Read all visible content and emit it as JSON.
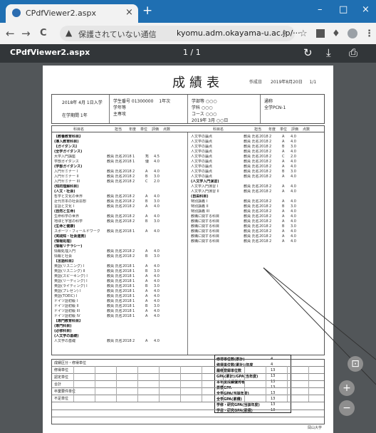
{
  "browser": {
    "tab_title": "CPdfViewer2.aspx",
    "tab_close": "×",
    "new_tab": "+",
    "win_min": "–",
    "win_max": "□",
    "win_close": "×"
  },
  "nav": {
    "back": "←",
    "forward": "→",
    "reload": "C"
  },
  "omnibox": {
    "warning": "▲",
    "security_text": "保護されていない通信",
    "url": "kyomu.adm.okayama-u.ac.jp/···"
  },
  "pdf": {
    "file_name": "CPdfViewer2.aspx",
    "page_indicator": "1 / 1"
  },
  "document": {
    "title": "成績表",
    "top_right": "作成日　　2019年8月20日 　 1/1",
    "header_cells": [
      "2018年 4月 1日入学",
      "在学期間 1年",
      "学生番号 01300000 　1年次",
      "学年等",
      "主専攻",
      "学部等 ○○○",
      "学科 ○○○",
      "コース ○○○",
      "2019年 3月 ○○日",
      "通称",
      "全学PCN-1"
    ],
    "column_headers": [
      "科目名",
      "担当",
      "年度",
      "単位",
      "評価",
      "点数",
      "科目名",
      "担当",
      "年度",
      "単位",
      "評価",
      "点数"
    ],
    "left_rows": [
      {
        "name": "【教養教育科目】",
        "bold": true
      },
      {
        "name": "(導入教育科目)",
        "bold": true
      },
      {
        "name": "【ガイダンス】",
        "bold": true
      },
      {
        "name": "(全学ガイダンス)",
        "bold": true
      },
      {
        "name": "大学入門講座",
        "d1": "教員 氏名",
        "d2": "2018",
        "d3": "1",
        "g": "秀",
        "r": "4.5"
      },
      {
        "name": "学部ガイダンス",
        "d1": "教員 氏名",
        "d2": "2018",
        "d3": "1",
        "g": "優",
        "r": "4.0"
      },
      {
        "name": "(学部ガイダンス)",
        "bold": true
      },
      {
        "name": "入門セミナー I",
        "d1": "教員 氏名",
        "d2": "2018",
        "d3": "2",
        "g": "A",
        "r": "4.0"
      },
      {
        "name": "入門セミナー II",
        "d1": "教員 氏名",
        "d2": "2018",
        "d3": "2",
        "g": "B",
        "r": "3.0"
      },
      {
        "name": "入門セミナー III",
        "d1": "教員 氏名",
        "d2": "2018",
        "d3": "2",
        "g": "C",
        "r": "2.0"
      },
      {
        "name": "(知的理解科目)",
        "bold": true
      },
      {
        "name": "(人文・社会)",
        "bold": true
      },
      {
        "name": "哲学と文化の世界",
        "d1": "教員 氏名",
        "d2": "2018",
        "d3": "2",
        "g": "A",
        "r": "4.0"
      },
      {
        "name": "近代日本の社会思想",
        "d1": "教員 氏名",
        "d2": "2018",
        "d3": "2",
        "g": "B",
        "r": "3.0"
      },
      {
        "name": "言語と文化 I",
        "d1": "教員 氏名",
        "d2": "2018",
        "d3": "2",
        "g": "A",
        "r": "4.0"
      },
      {
        "name": "(自然と生命)",
        "bold": true
      },
      {
        "name": "生命科学の世界",
        "d1": "教員 氏名",
        "d2": "2018",
        "d3": "2",
        "g": "A",
        "r": "4.0"
      },
      {
        "name": "地球と宇宙の科学",
        "d1": "教員 氏名",
        "d2": "2018",
        "d3": "2",
        "g": "B",
        "r": "3.0"
      },
      {
        "name": "(生命と健康)",
        "bold": true
      },
      {
        "name": "スポーツ・フィールドワーク",
        "d1": "教員 氏名",
        "d2": "2018",
        "d3": "1",
        "g": "A",
        "r": "4.0"
      },
      {
        "name": "(実践知・社会連携)",
        "bold": true
      },
      {
        "name": "(情報処理)",
        "bold": true
      },
      {
        "name": "(情報リテラシー)",
        "bold": true
      },
      {
        "name": "情報処理入門",
        "d1": "教員 氏名",
        "d2": "2018",
        "d3": "2",
        "g": "A",
        "r": "4.0"
      },
      {
        "name": "情報と社会",
        "d1": "教員 氏名",
        "d2": "2018",
        "d3": "2",
        "g": "B",
        "r": "3.0"
      },
      {
        "name": "【言語科目】",
        "bold": true
      },
      {
        "name": "英語(リスニング) I",
        "d1": "教員 氏名",
        "d2": "2018",
        "d3": "1",
        "g": "A",
        "r": "4.0"
      },
      {
        "name": "英語(リスニング) II",
        "d1": "教員 氏名",
        "d2": "2018",
        "d3": "1",
        "g": "B",
        "r": "3.0"
      },
      {
        "name": "英語(スピーキング) I",
        "d1": "教員 氏名",
        "d2": "2018",
        "d3": "1",
        "g": "A",
        "r": "4.0"
      },
      {
        "name": "英語(リーディング) I",
        "d1": "教員 氏名",
        "d2": "2018",
        "d3": "1",
        "g": "A",
        "r": "4.0"
      },
      {
        "name": "英語(ライティング) I",
        "d1": "教員 氏名",
        "d2": "2018",
        "d3": "1",
        "g": "B",
        "r": "3.0"
      },
      {
        "name": "英語(プレゼン) I",
        "d1": "教員 氏名",
        "d2": "2018",
        "d3": "1",
        "g": "A",
        "r": "4.0"
      },
      {
        "name": "英語(TOEIC) I",
        "d1": "教員 氏名",
        "d2": "2018",
        "d3": "1",
        "g": "A",
        "r": "4.0"
      },
      {
        "name": "ドイツ語初級 I",
        "d1": "教員 氏名",
        "d2": "2018",
        "d3": "1",
        "g": "A",
        "r": "4.0"
      },
      {
        "name": "ドイツ語初級 II",
        "d1": "教員 氏名",
        "d2": "2018",
        "d3": "1",
        "g": "B",
        "r": "3.0"
      },
      {
        "name": "ドイツ語初級 III",
        "d1": "教員 氏名",
        "d2": "2018",
        "d3": "1",
        "g": "A",
        "r": "4.0"
      },
      {
        "name": "ドイツ語初級 IV",
        "d1": "教員 氏名",
        "d2": "2018",
        "d3": "1",
        "g": "A",
        "r": "4.0"
      },
      {
        "name": "【専門教育科目】",
        "bold": true
      },
      {
        "name": "(専門科目)",
        "bold": true
      },
      {
        "name": "(必修科目)",
        "bold": true
      },
      {
        "name": "(人文学の基礎)",
        "bold": true
      },
      {
        "name": "人文学の基礎",
        "d1": "教員 氏名",
        "d2": "2018",
        "d3": "2",
        "g": "A",
        "r": "4.0"
      }
    ],
    "right_rows": [
      {
        "name": "人文学の論点",
        "d1": "教員 氏名",
        "d2": "2018",
        "d3": "2",
        "g": "A",
        "r": "4.0"
      },
      {
        "name": "人文学の論点",
        "d1": "教員 氏名",
        "d2": "2018",
        "d3": "2",
        "g": "A",
        "r": "4.0"
      },
      {
        "name": "人文学の論点",
        "d1": "教員 氏名",
        "d2": "2018",
        "d3": "2",
        "g": "B",
        "r": "3.0"
      },
      {
        "name": "人文学の論点",
        "d1": "教員 氏名",
        "d2": "2018",
        "d3": "2",
        "g": "A",
        "r": "4.0"
      },
      {
        "name": "人文学の論点",
        "d1": "教員 氏名",
        "d2": "2018",
        "d3": "2",
        "g": "C",
        "r": "2.0"
      },
      {
        "name": "人文学の論点",
        "d1": "教員 氏名",
        "d2": "2018",
        "d3": "2",
        "g": "A",
        "r": "4.0"
      },
      {
        "name": "人文学の論点",
        "d1": "教員 氏名",
        "d2": "2018",
        "d3": "2",
        "g": "A",
        "r": "4.0"
      },
      {
        "name": "人文学の論点",
        "d1": "教員 氏名",
        "d2": "2018",
        "d3": "2",
        "g": "B",
        "r": "3.0"
      },
      {
        "name": "人文学の論点",
        "d1": "教員 氏名",
        "d2": "2018",
        "d3": "2",
        "g": "A",
        "r": "4.0"
      },
      {
        "name": "(人文学入門演習)",
        "bold": true
      },
      {
        "name": "人文学入門演習 I",
        "d1": "教員 氏名",
        "d2": "2018",
        "d3": "2",
        "g": "A",
        "r": "4.0"
      },
      {
        "name": "人文学入門演習 II",
        "d1": "教員 氏名",
        "d2": "2018",
        "d3": "2",
        "g": "A",
        "r": "4.0"
      },
      {
        "name": "(自由科目)",
        "bold": true
      },
      {
        "name": "特別講義 I",
        "d1": "教員 氏名",
        "d2": "2018",
        "d3": "2",
        "g": "A",
        "r": "4.0"
      },
      {
        "name": "特別講義 II",
        "d1": "教員 氏名",
        "d2": "2018",
        "d3": "2",
        "g": "B",
        "r": "3.0"
      },
      {
        "name": "特別講義 III",
        "d1": "教員 氏名",
        "d2": "2018",
        "d3": "2",
        "g": "A",
        "r": "4.0"
      },
      {
        "name": "教職に関する科目",
        "d1": "教員 氏名",
        "d2": "2018",
        "d3": "2",
        "g": "A",
        "r": "4.0"
      },
      {
        "name": "教職に関する科目",
        "d1": "教員 氏名",
        "d2": "2018",
        "d3": "2",
        "g": "A",
        "r": "4.0"
      },
      {
        "name": "教職に関する科目",
        "d1": "教員 氏名",
        "d2": "2018",
        "d3": "2",
        "g": "B",
        "r": "3.0"
      },
      {
        "name": "教職に関する科目",
        "d1": "教員 氏名",
        "d2": "2018",
        "d3": "2",
        "g": "A",
        "r": "4.0"
      },
      {
        "name": "教職に関する科目",
        "d1": "教員 氏名",
        "d2": "2018",
        "d3": "2",
        "g": "A",
        "r": "4.0"
      },
      {
        "name": "教職に関する科目",
        "d1": "教員 氏名",
        "d2": "2018",
        "d3": "2",
        "g": "A",
        "r": "4.0"
      }
    ],
    "summary_lines": [
      {
        "label": "修得単位数(累計)",
        "value": "4"
      },
      {
        "label": "修得単位数(累計)/年度",
        "value": "4"
      },
      {
        "label": "履修登録単位数",
        "value": "13"
      },
      {
        "label": "GPA(累計)/GPA(当年度)",
        "value": "13"
      },
      {
        "label": "本年度成績優秀者",
        "value": "13"
      },
      {
        "label": "累積GPA",
        "value": "13"
      },
      {
        "label": "全学GPA(当該年度)",
        "value": "13"
      },
      {
        "label": "全学GPA(累積)",
        "value": "13"
      },
      {
        "label": "学修・研究GPA(当該年度)",
        "value": "13"
      },
      {
        "label": "学修・研究GPA(累積)",
        "value": "13"
      }
    ],
    "bottom_label": "成績区分・修得単位",
    "bottom_rows": [
      "修得単位",
      "認定単位",
      "合計",
      "卒業要件単位",
      "不足単位"
    ],
    "footer": "岡山大学"
  },
  "zoom": {
    "fit": "⊡",
    "in": "+",
    "out": "−"
  }
}
